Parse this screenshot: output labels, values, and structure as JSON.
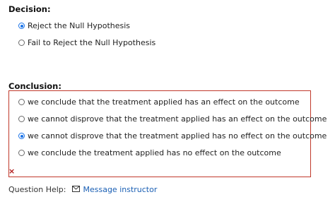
{
  "decision": {
    "heading": "Decision:",
    "options": [
      {
        "label": "Reject the Null Hypothesis",
        "selected": true
      },
      {
        "label": "Fail to Reject the Null Hypothesis",
        "selected": false
      }
    ]
  },
  "conclusion": {
    "heading": "Conclusion:",
    "options": [
      {
        "label": "we conclude that the treatment applied has an effect on the outcome",
        "selected": false
      },
      {
        "label": "we cannot disprove that the treatment applied has an effect on the outcome",
        "selected": false
      },
      {
        "label": "we cannot disprove that the treatment applied has no effect on the outcome",
        "selected": true
      },
      {
        "label": "we conclude the treatment applied has no effect on the outcome",
        "selected": false
      }
    ],
    "status_mark": "×",
    "status_color": "#b11919"
  },
  "help": {
    "label": "Question Help:",
    "icon": "envelope-icon",
    "link_label": "Message instructor"
  },
  "colors": {
    "accent": "#1a73e8",
    "error_border": "#c0392b",
    "link": "#1a5fb4"
  }
}
